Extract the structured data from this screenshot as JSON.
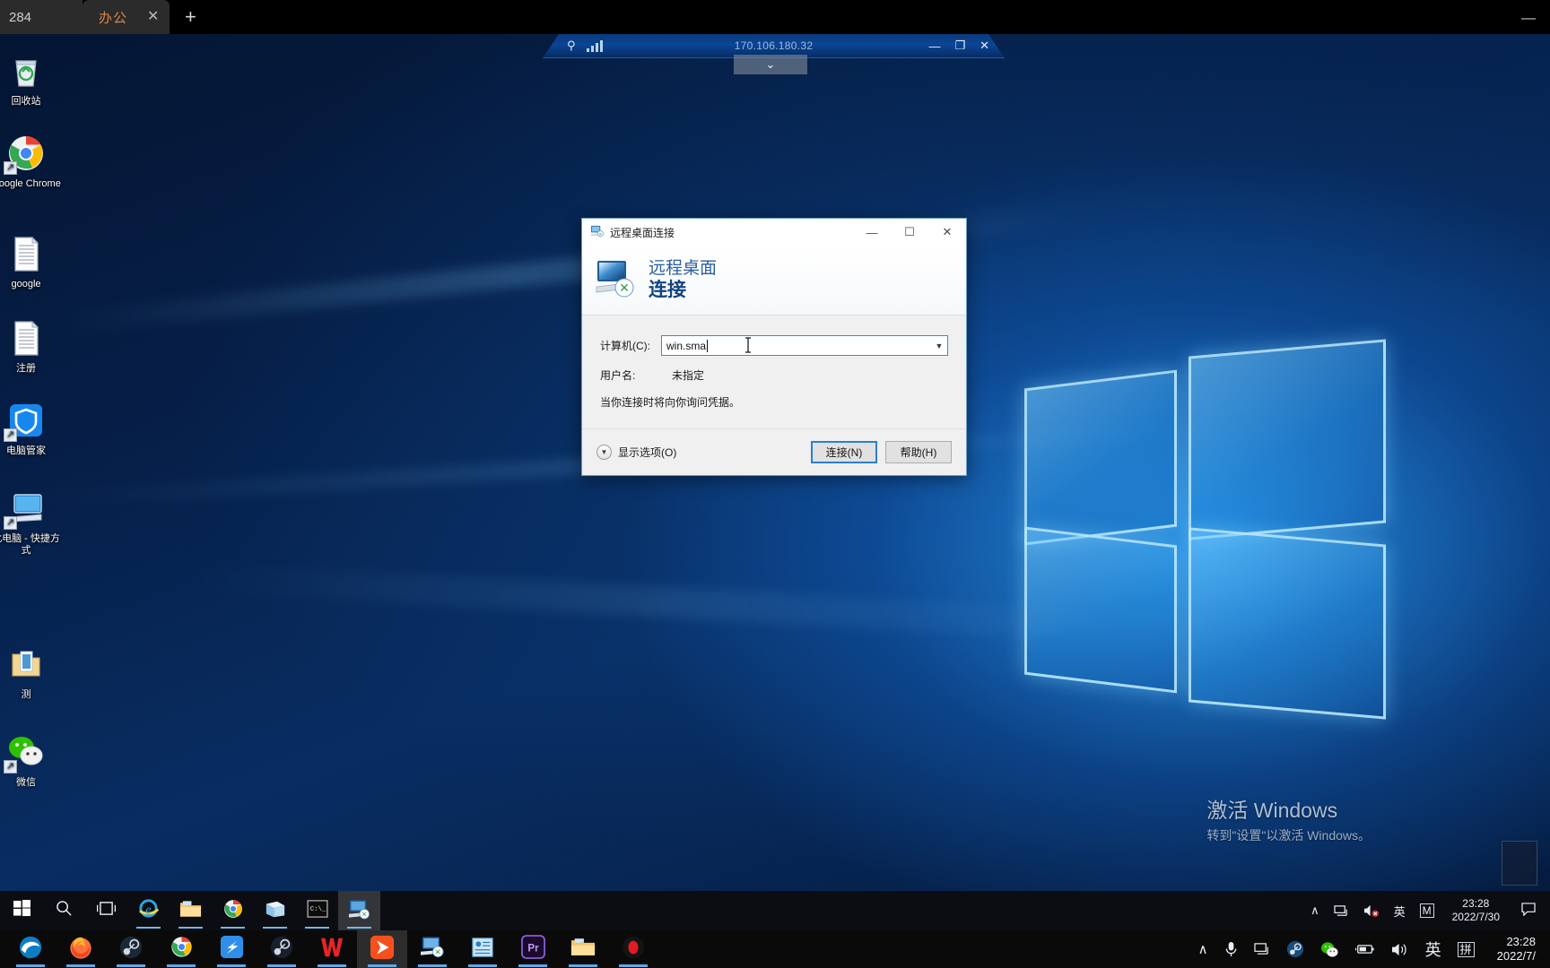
{
  "browser": {
    "partial_tab_label": "284",
    "active_tab": {
      "label": "办公",
      "close": "✕"
    },
    "new_tab": "+",
    "minimize": "—"
  },
  "rdp_connection_bar": {
    "pin_icon": "pin-icon",
    "signal_icon": "signal-bars-icon",
    "address": "170.106.180.32",
    "minimize": "—",
    "restore": "❐",
    "close": "✕",
    "dropdown_tab": "⌄"
  },
  "desktop_icons": [
    {
      "label": "回收站",
      "icon": "recycle-bin-icon",
      "shortcut": false
    },
    {
      "label": "Google Chrome",
      "icon": "chrome-icon",
      "shortcut": true
    },
    {
      "label": "google",
      "icon": "text-document-icon",
      "shortcut": false
    },
    {
      "label": "注册",
      "icon": "text-document-icon",
      "shortcut": false
    },
    {
      "label": "电脑管家",
      "icon": "pc-manager-shield-icon",
      "shortcut": true
    },
    {
      "label": "此电脑 - 快捷方式",
      "icon": "this-pc-icon",
      "shortcut": true
    },
    {
      "label": "测",
      "icon": "folder-icon",
      "shortcut": false
    },
    {
      "label": "微信",
      "icon": "wechat-icon",
      "shortcut": true
    }
  ],
  "dialog": {
    "window_title": "远程桌面连接",
    "title_icon": "remote-desktop-icon",
    "header_line1": "远程桌面",
    "header_line2": "连接",
    "header_icon": "remote-desktop-large-icon",
    "minimize": "—",
    "maximize": "☐",
    "close": "✕",
    "computer_label": "计算机(C):",
    "computer_value": "win.sma",
    "computer_dropdown_icon": "chevron-down-icon",
    "username_label": "用户名:",
    "username_value": "未指定",
    "hint": "当你连接时将向你询问凭据。",
    "show_options_label": "显示选项(O)",
    "show_options_icon": "chevron-down-circle-icon",
    "connect_button": "连接(N)",
    "help_button": "帮助(H)"
  },
  "watermark": {
    "line1": "激活 Windows",
    "line2": "转到\"设置\"以激活 Windows。"
  },
  "guest_taskbar": {
    "items": [
      {
        "name": "start-button",
        "icon": "windows-logo-icon"
      },
      {
        "name": "search-button",
        "icon": "search-icon"
      },
      {
        "name": "task-view-button",
        "icon": "task-view-icon"
      },
      {
        "name": "internet-explorer",
        "icon": "internet-explorer-icon"
      },
      {
        "name": "file-explorer",
        "icon": "folder-icon"
      },
      {
        "name": "google-chrome",
        "icon": "chrome-icon"
      },
      {
        "name": "sticky-notes",
        "icon": "sticky-notes-icon"
      },
      {
        "name": "command-prompt",
        "icon": "command-prompt-icon"
      },
      {
        "name": "remote-desktop",
        "icon": "remote-desktop-icon"
      }
    ],
    "tray": {
      "overflow": "∧",
      "network_icon": "network-icon",
      "volume_icon": "volume-muted-icon",
      "ime": "英",
      "ime_mode": "M",
      "time": "23:28",
      "date": "2022/7/30",
      "notification_icon": "notification-icon"
    }
  },
  "host_taskbar": {
    "items": [
      {
        "name": "edge-app",
        "icon": "edge-icon"
      },
      {
        "name": "firefox-app",
        "icon": "firefox-icon"
      },
      {
        "name": "steam-app",
        "icon": "steam-icon"
      },
      {
        "name": "chrome-app",
        "icon": "chrome-icon"
      },
      {
        "name": "bird-app",
        "icon": "bird-icon"
      },
      {
        "name": "steam-app-2",
        "icon": "steam-icon"
      },
      {
        "name": "wps-app",
        "icon": "wps-icon"
      },
      {
        "name": "orange-app",
        "icon": "orange-play-icon"
      },
      {
        "name": "remote-desktop-app",
        "icon": "remote-desktop-icon"
      },
      {
        "name": "notes-app",
        "icon": "blue-notes-icon"
      },
      {
        "name": "premiere-app",
        "icon": "premiere-icon"
      },
      {
        "name": "file-explorer-app",
        "icon": "folder-icon"
      },
      {
        "name": "record-app",
        "icon": "record-icon"
      }
    ],
    "tray": {
      "overflow": "∧",
      "mic_icon": "microphone-icon",
      "display_icon": "display-icon",
      "steam_icon": "steam-icon",
      "wechat_icon": "wechat-icon",
      "battery_icon": "battery-icon",
      "volume_icon": "volume-icon",
      "ime": "英",
      "ime_pinyin": "拼",
      "time": "23:28",
      "date": "2022/7/"
    }
  },
  "colors": {
    "accent_blue": "#2a7fd4",
    "dialog_bg": "#f0f0f0",
    "tab_orange": "#d8854a",
    "header_blue": "#11437f"
  }
}
